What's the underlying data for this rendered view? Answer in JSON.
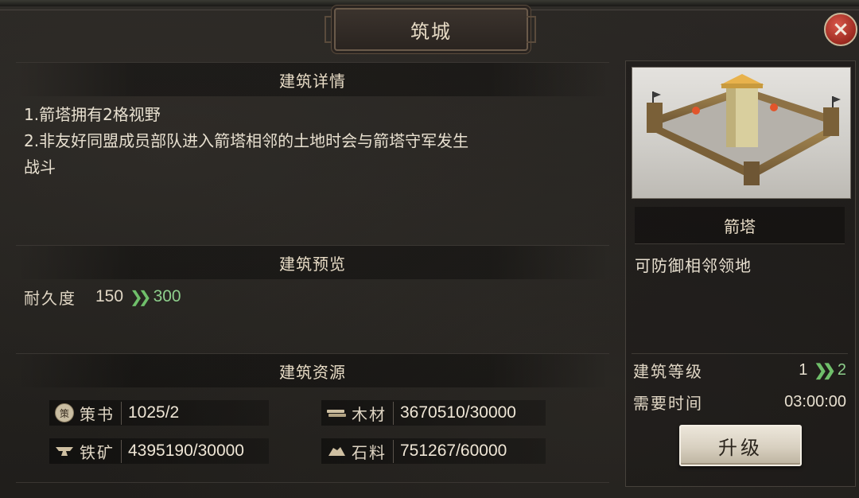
{
  "window": {
    "title": "筑城",
    "close_icon": "×"
  },
  "details": {
    "header": "建筑详情",
    "lines": [
      "1.箭塔拥有2格视野",
      "2.非友好同盟成员部队进入箭塔相邻的土地时会与箭塔守军发生",
      "战斗"
    ]
  },
  "preview_section": {
    "header": "建筑预览",
    "durability_label": "耐久度",
    "durability_current": "150",
    "durability_next": "300"
  },
  "resources": {
    "header": "建筑资源",
    "items": [
      {
        "icon": "book-seal-icon",
        "seal_char": "策",
        "name": "策书",
        "value": "1025/2"
      },
      {
        "icon": "wood-icon",
        "name": "木材",
        "value": "3670510/30000"
      },
      {
        "icon": "iron-anvil-icon",
        "name": "铁矿",
        "value": "4395190/30000"
      },
      {
        "icon": "stone-icon",
        "name": "石料",
        "value": "751267/60000"
      }
    ]
  },
  "building": {
    "name": "箭塔",
    "description": "可防御相邻领地",
    "level_label": "建筑等级",
    "level_current": "1",
    "level_next": "2",
    "time_label": "需要时间",
    "time_value": "03:00:00",
    "upgrade_label": "升级"
  },
  "colors": {
    "accent_green": "#8ecf8c",
    "close_red": "#b3362a",
    "panel_bg": "#24221f"
  }
}
